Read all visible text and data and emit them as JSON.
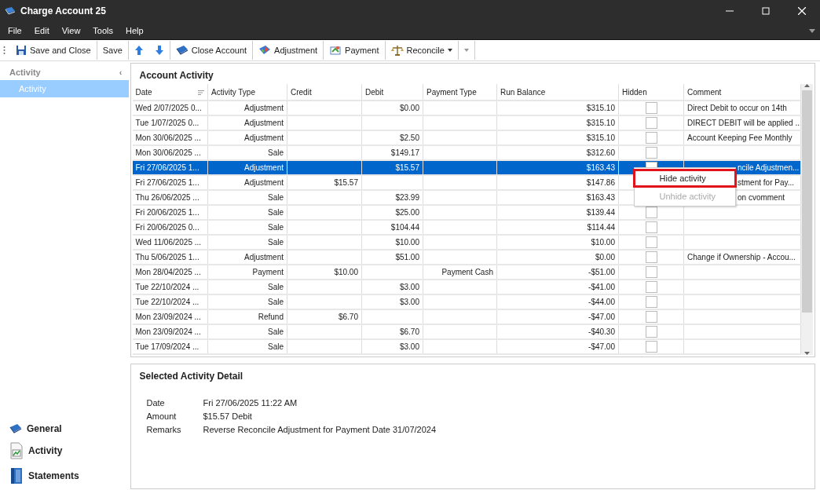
{
  "window": {
    "title": "Charge Account 25"
  },
  "menu_bar": [
    "File",
    "Edit",
    "View",
    "Tools",
    "Help"
  ],
  "toolbar": [
    {
      "kind": "save",
      "label": "Save and Close"
    },
    {
      "kind": "plain",
      "label": "Save"
    },
    {
      "kind": "up"
    },
    {
      "kind": "down"
    },
    {
      "kind": "book",
      "label": "Close Account"
    },
    {
      "kind": "adjust",
      "label": "Adjustment"
    },
    {
      "kind": "payment",
      "label": "Payment"
    },
    {
      "kind": "scales",
      "label": "Reconcile",
      "dropdown": true
    }
  ],
  "sidebar": {
    "header": "Activity",
    "collapse": "‹",
    "items": [
      {
        "label": "Activity",
        "selected": true
      }
    ],
    "nav": [
      {
        "kind": "book",
        "label": "General"
      },
      {
        "kind": "chart",
        "label": "Activity"
      },
      {
        "kind": "binder",
        "label": "Statements"
      }
    ]
  },
  "activity": {
    "title": "Account Activity",
    "columns": [
      "Date",
      "Activity Type",
      "Credit",
      "Debit",
      "Payment Type",
      "Run Balance",
      "Hidden",
      "Comment"
    ],
    "rows": [
      {
        "date": "Wed 2/07/2025 0...",
        "type": "Adjustment",
        "credit": "",
        "debit": "$0.00",
        "payment_type": "",
        "balance": "$315.10",
        "hidden": false,
        "comment": "Direct Debit to occur on 14th",
        "selected": false
      },
      {
        "date": "Tue 1/07/2025 0...",
        "type": "Adjustment",
        "credit": "",
        "debit": "",
        "payment_type": "",
        "balance": "$315.10",
        "hidden": false,
        "comment": "DIRECT DEBIT will be applied ...",
        "selected": false
      },
      {
        "date": "Mon 30/06/2025 ...",
        "type": "Adjustment",
        "credit": "",
        "debit": "$2.50",
        "payment_type": "",
        "balance": "$315.10",
        "hidden": false,
        "comment": "Account Keeping Fee Monthly",
        "selected": false
      },
      {
        "date": "Mon 30/06/2025 ...",
        "type": "Sale",
        "credit": "",
        "debit": "$149.17",
        "payment_type": "",
        "balance": "$312.60",
        "hidden": false,
        "comment": "",
        "selected": false
      },
      {
        "date": "Fri 27/06/2025 1...",
        "type": "Adjustment",
        "credit": "",
        "debit": "$15.57",
        "payment_type": "",
        "balance": "$163.43",
        "hidden": false,
        "comment": "ncile Adjustmen...",
        "comment_covered": true,
        "selected": true
      },
      {
        "date": "Fri 27/06/2025 1...",
        "type": "Adjustment",
        "credit": "$15.57",
        "debit": "",
        "payment_type": "",
        "balance": "$147.86",
        "comment": "stment for Pay...",
        "comment_covered": true,
        "selected": false
      },
      {
        "date": "Thu 26/06/2025 ...",
        "type": "Sale",
        "credit": "",
        "debit": "$23.99",
        "payment_type": "",
        "balance": "$163.43",
        "comment": "on cvomment",
        "comment_covered": true,
        "selected": false
      },
      {
        "date": "Fri 20/06/2025 1...",
        "type": "Sale",
        "credit": "",
        "debit": "$25.00",
        "payment_type": "",
        "balance": "$139.44",
        "hidden": false,
        "comment": "",
        "selected": false
      },
      {
        "date": "Fri 20/06/2025 0...",
        "type": "Sale",
        "credit": "",
        "debit": "$104.44",
        "payment_type": "",
        "balance": "$114.44",
        "hidden": false,
        "comment": "",
        "selected": false
      },
      {
        "date": "Wed 11/06/2025 ...",
        "type": "Sale",
        "credit": "",
        "debit": "$10.00",
        "payment_type": "",
        "balance": "$10.00",
        "hidden": false,
        "comment": "",
        "selected": false
      },
      {
        "date": "Thu 5/06/2025 1...",
        "type": "Adjustment",
        "credit": "",
        "debit": "$51.00",
        "payment_type": "",
        "balance": "$0.00",
        "hidden": false,
        "comment": "Change if Ownership - Accou...",
        "selected": false
      },
      {
        "date": "Mon 28/04/2025 ...",
        "type": "Payment",
        "credit": "$10.00",
        "debit": "",
        "payment_type": "Payment Cash",
        "balance": "-$51.00",
        "hidden": false,
        "comment": "",
        "selected": false
      },
      {
        "date": "Tue 22/10/2024 ...",
        "type": "Sale",
        "credit": "",
        "debit": "$3.00",
        "payment_type": "",
        "balance": "-$41.00",
        "hidden": false,
        "comment": "",
        "selected": false
      },
      {
        "date": "Tue 22/10/2024 ...",
        "type": "Sale",
        "credit": "",
        "debit": "$3.00",
        "payment_type": "",
        "balance": "-$44.00",
        "hidden": false,
        "comment": "",
        "selected": false
      },
      {
        "date": "Mon 23/09/2024 ...",
        "type": "Refund",
        "credit": "$6.70",
        "debit": "",
        "payment_type": "",
        "balance": "-$47.00",
        "hidden": false,
        "comment": "",
        "selected": false
      },
      {
        "date": "Mon 23/09/2024 ...",
        "type": "Sale",
        "credit": "",
        "debit": "$6.70",
        "payment_type": "",
        "balance": "-$40.30",
        "hidden": false,
        "comment": "",
        "selected": false
      },
      {
        "date": "Tue 17/09/2024 ...",
        "type": "Sale",
        "credit": "",
        "debit": "$3.00",
        "payment_type": "",
        "balance": "-$47.00",
        "hidden": false,
        "comment": "",
        "selected": false
      }
    ]
  },
  "context_menu": [
    {
      "label": "Hide activity",
      "disabled": false,
      "highlighted": true
    },
    {
      "label": "Unhide activity",
      "disabled": true,
      "highlighted": false
    }
  ],
  "detail": {
    "title": "Selected Activity Detail",
    "fields": [
      {
        "label": "Date",
        "value": "Fri 27/06/2025 11:22 AM"
      },
      {
        "label": "Amount",
        "value": "$15.57 Debit"
      },
      {
        "label": "Remarks",
        "value": "Reverse Reconcile Adjustment for Payment Date 31/07/2024"
      }
    ]
  }
}
